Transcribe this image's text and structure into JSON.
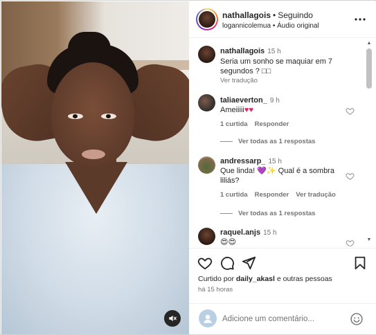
{
  "header": {
    "username": "nathallagois",
    "separator": "•",
    "follow_state": "Seguindo",
    "audio_line": "logannicolemua • Áudio original"
  },
  "caption": {
    "username": "nathallagois",
    "time": "15 h",
    "text": "Seria um sonho se maquiar em 7 segundos ? □□",
    "see_translation": "Ver tradução"
  },
  "comments": [
    {
      "username": "taliaeverton_",
      "time": "9 h",
      "text": "Ameiiiii",
      "emoji": "♥♥",
      "likes": "1 curtida",
      "reply": "Responder",
      "view_replies": "Ver todas as 1 respostas"
    },
    {
      "username": "andressarp_",
      "time": "15 h",
      "text": "Que linda! 💜✨ Qual é a sombra liliás?",
      "likes": "1 curtida",
      "reply": "Responder",
      "translate": "Ver tradução",
      "view_replies": "Ver todas as 1 respostas"
    },
    {
      "username": "raquel.anjs",
      "time": "15 h",
      "text": "😍😍"
    }
  ],
  "actions": {
    "liked_prefix": "Curtido por",
    "liked_user": "daily_akasl",
    "liked_suffix": "e outras pessoas",
    "timestamp": "há 15 horas"
  },
  "add_comment": {
    "placeholder": "Adicione um comentário..."
  },
  "colors": {
    "text": "#262626",
    "secondary": "#737373",
    "like_red": "#e0245e"
  },
  "icons": [
    "more-icon",
    "heart-icon",
    "comment-icon",
    "share-icon",
    "bookmark-icon",
    "mute-icon",
    "emoji-icon"
  ]
}
